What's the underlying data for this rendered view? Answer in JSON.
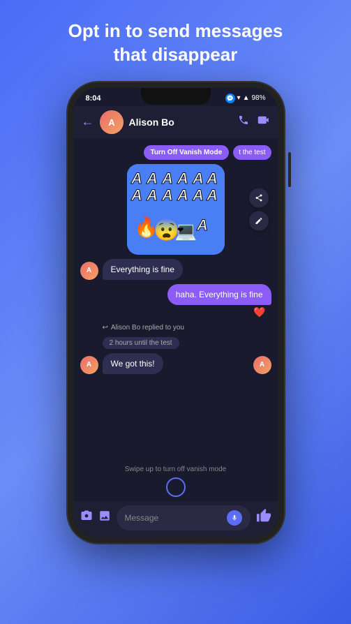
{
  "headline": {
    "line1": "Opt in to send messages",
    "line2": "that disappear"
  },
  "status_bar": {
    "time": "8:04",
    "battery": "98%"
  },
  "header": {
    "contact_name": "Alison Bo",
    "back_label": "←"
  },
  "vanish_mode": {
    "btn1": "Turn Off Vanish Mode",
    "btn2": "t the test"
  },
  "messages": [
    {
      "type": "sticker",
      "letters": "A A A A A A\nA A A A A A A A"
    },
    {
      "type": "received",
      "text": "Everything is fine"
    },
    {
      "type": "sent",
      "text": "haha. Everything is fine",
      "reaction": "❤️"
    },
    {
      "type": "reply_info",
      "text": "Alison Bo replied to you"
    },
    {
      "type": "time_chip",
      "text": "2 hours until the test"
    },
    {
      "type": "received",
      "text": "We got this!"
    }
  ],
  "swipe_hint": "Swipe up to turn off vanish mode",
  "input": {
    "placeholder": "Message",
    "camera_icon": "📷",
    "image_icon": "🖼️",
    "mic_icon": "🎤",
    "thumb_icon": "👍"
  },
  "icons": {
    "back": "←",
    "phone": "📞",
    "video": "📹",
    "share": "⬆",
    "edit": "✏️"
  }
}
